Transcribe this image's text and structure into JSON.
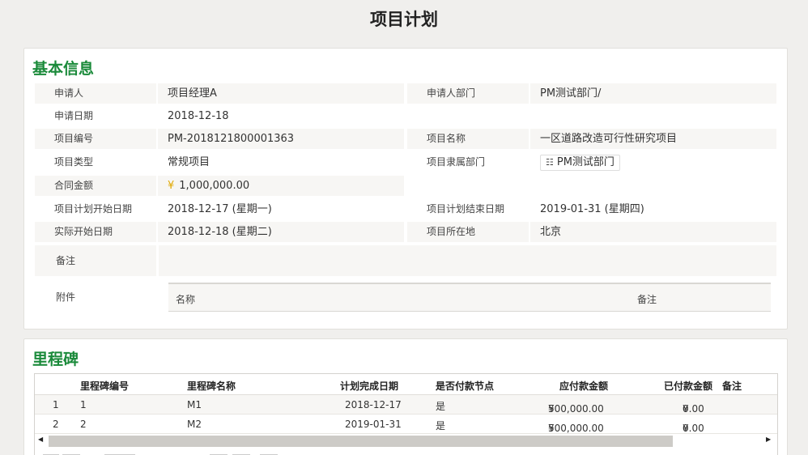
{
  "page": {
    "title": "项目计划"
  },
  "basic": {
    "section_title": "基本信息",
    "applicant_label": "申请人",
    "applicant": "项目经理A",
    "applicant_dept_label": "申请人部门",
    "applicant_dept": "PM测试部门/",
    "apply_date_label": "申请日期",
    "apply_date": "2018-12-18",
    "project_no_label": "项目编号",
    "project_no": "PM-2018121800001363",
    "project_name_label": "项目名称",
    "project_name": "一区道路改造可行性研究项目",
    "project_type_label": "项目类型",
    "project_type": "常规项目",
    "project_dept_label": "项目隶属部门",
    "project_dept": "PM测试部门",
    "contract_amount_label": "合同金额",
    "currency": "¥",
    "contract_amount": "1,000,000.00",
    "plan_start_label": "项目计划开始日期",
    "plan_start": "2018-12-17 (星期一)",
    "plan_end_label": "项目计划结束日期",
    "plan_end": "2019-01-31 (星期四)",
    "actual_start_label": "实际开始日期",
    "actual_start": "2018-12-18 (星期二)",
    "location_label": "项目所在地",
    "location": "北京",
    "remark_label": "备注",
    "remark": "",
    "attachment_label": "附件",
    "attachment_columns": {
      "name": "名称",
      "remark": "备注"
    }
  },
  "milestone": {
    "section_title": "里程碑",
    "columns": {
      "no": "里程碑编号",
      "name": "里程碑名称",
      "due": "计划完成日期",
      "is_payment": "是否付款节点",
      "payable": "应付款金额",
      "paid": "已付款金额",
      "remark": "备注"
    },
    "rows": [
      {
        "index": "1",
        "no": "1",
        "name": "M1",
        "due": "2018-12-17",
        "is_payment": "是",
        "payable": "500,000.00",
        "paid": "0.00"
      },
      {
        "index": "2",
        "no": "2",
        "name": "M2",
        "due": "2019-01-31",
        "is_payment": "是",
        "payable": "500,000.00",
        "paid": "0.00"
      }
    ],
    "scroll": {
      "left_arrow": "◀",
      "right_arrow": "▶"
    }
  },
  "colors": {
    "section_title": "#1a8a3a",
    "currency": "#e0a800",
    "row_shade": "#f7f6f4"
  },
  "icons": {
    "org": "org-chart-icon"
  }
}
